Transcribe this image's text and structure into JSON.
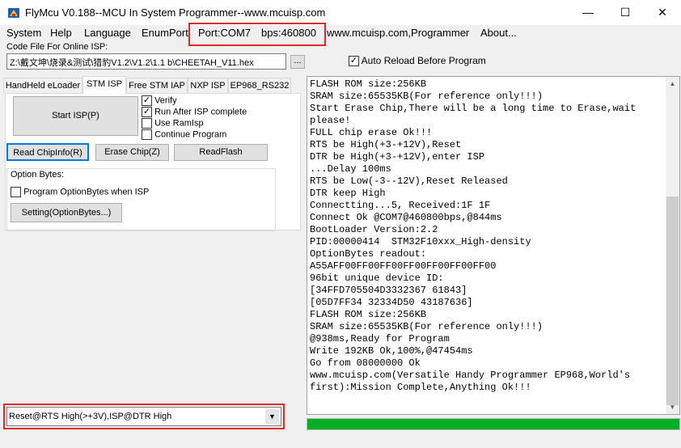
{
  "window": {
    "title": "FlyMcu V0.188--MCU In System Programmer--www.mcuisp.com",
    "minimize": "—",
    "maximize": "☐",
    "close": "✕"
  },
  "menu": {
    "system": "System",
    "help": "Help",
    "language": "Language",
    "enumport": "EnumPort",
    "port": "Port:COM7",
    "bps": "bps:460800",
    "website": "www.mcuisp.com,Programmer",
    "about": "About..."
  },
  "codefile": {
    "label": "Code File For Online ISP:",
    "path": "Z:\\戴文坤\\烧录&测试\\猎豹V1.2\\V1.2\\1.1 b\\CHEETAH_V11.hex",
    "browse": "...",
    "auto_reload_label": "Auto Reload Before Program",
    "auto_reload_checked": true
  },
  "tabs": [
    "HandHeld eLoader",
    "STM ISP",
    "Free STM IAP",
    "NXP ISP",
    "EP968_RS232"
  ],
  "active_tab": "STM ISP",
  "stm": {
    "start_isp": "Start ISP(P)",
    "options": [
      {
        "label": "Verify",
        "checked": true
      },
      {
        "label": "Run After ISP complete",
        "checked": true
      },
      {
        "label": "Use RamIsp",
        "checked": false
      },
      {
        "label": "Continue Program",
        "checked": false
      }
    ],
    "read_chipinfo": "Read ChipInfo(R)",
    "erase_chip": "Erase Chip(Z)",
    "read_flash": "ReadFlash",
    "option_bytes_title": "Option Bytes:",
    "program_optionbytes_label": "Program OptionBytes when ISP",
    "program_optionbytes_checked": false,
    "setting_optionbytes": "Setting(OptionBytes...)"
  },
  "reset_mode": "Reset@RTS High(>+3V),ISP@DTR High",
  "log_lines": [
    "FLASH ROM size:256KB",
    "SRAM size:65535KB(For reference only!!!)",
    "Start Erase Chip,There will be a long time to Erase,wait please!",
    "FULL chip erase Ok!!!",
    "RTS be High(+3-+12V),Reset",
    "DTR be High(+3-+12V),enter ISP",
    "...Delay 100ms",
    "RTS be Low(-3--12V),Reset Released",
    "DTR keep High",
    "Connectting...5, Received:1F 1F",
    "Connect Ok @COM7@460800bps,@844ms",
    "BootLoader Version:2.2",
    "PID:00000414  STM32F10xxx_High-density",
    "OptionBytes readout:",
    "A55AFF00FF00FF00FF00FF00FF00FF00",
    "96bit unique device ID:",
    "[34FFD705504D3332367 61843]",
    "[05D7FF34 32334D50 43187636]",
    "FLASH ROM size:256KB",
    "SRAM size:65535KB(For reference only!!!)",
    "@938ms,Ready for Program",
    "Write 192KB Ok,100%,@47454ms",
    "Go from 08000000 Ok",
    "www.mcuisp.com(Versatile Handy Programmer EP968,World's first):Mission Complete,Anything Ok!!!"
  ],
  "progress_percent": 100,
  "colors": {
    "progress": "#06b025",
    "highlight_box": "#e0272a",
    "focus": "#0078d7"
  }
}
